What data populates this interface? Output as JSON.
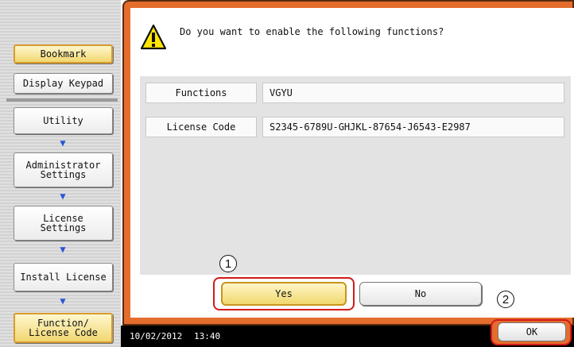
{
  "sidebar": {
    "bookmark": "Bookmark",
    "display_keypad": "Display Keypad",
    "steps": [
      {
        "label": "Utility"
      },
      {
        "label": "Administrator\nSettings"
      },
      {
        "label": "License\nSettings"
      },
      {
        "label": "Install License"
      },
      {
        "label": "Function/\nLicense Code"
      }
    ],
    "arrow": "▼"
  },
  "dialog": {
    "message": "Do you want to enable the following functions?",
    "icon": "warning-icon",
    "fields": [
      {
        "label": "Functions",
        "value": "VGYU"
      },
      {
        "label": "License Code",
        "value": "S2345-6789U-GHJKL-87654-J6543-E2987"
      }
    ],
    "yes_label": "Yes",
    "no_label": "No"
  },
  "annotations": {
    "step1": "1",
    "step2": "2"
  },
  "statusbar": {
    "date": "10/02/2012",
    "time": "13:40",
    "ok_label": "OK"
  },
  "colors": {
    "frame": "#e46d2d",
    "highlight": "#d31a1a",
    "selected_button": "#f0d86d",
    "arrow": "#2a56d4"
  }
}
